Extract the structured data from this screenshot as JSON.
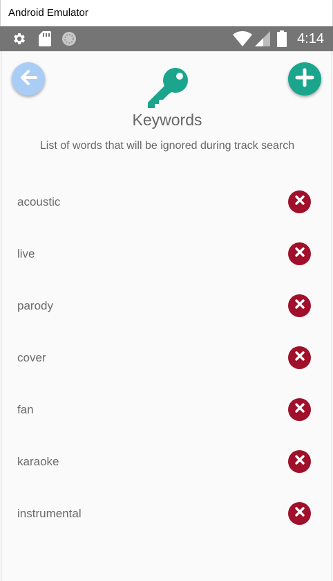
{
  "window": {
    "title": "Android Emulator"
  },
  "status_bar": {
    "time": "4:14",
    "icons": [
      "gear-icon",
      "sd-card-icon",
      "sync-icon",
      "wifi-icon",
      "signal-icon",
      "battery-icon"
    ]
  },
  "header": {
    "back_icon": "arrow-left-icon",
    "add_icon": "plus-icon",
    "title_icon": "key-icon",
    "title": "Keywords",
    "subtitle": "List of words that will be ignored during track search"
  },
  "keywords": [
    {
      "label": "acoustic"
    },
    {
      "label": "live"
    },
    {
      "label": "parody"
    },
    {
      "label": "cover"
    },
    {
      "label": "fan"
    },
    {
      "label": "karaoke"
    },
    {
      "label": "instrumental"
    }
  ],
  "colors": {
    "accent": "#1ba58c",
    "back_button": "#a9cdf5",
    "delete_button": "#a0102a",
    "status_bar": "#757575",
    "text": "#666666"
  }
}
